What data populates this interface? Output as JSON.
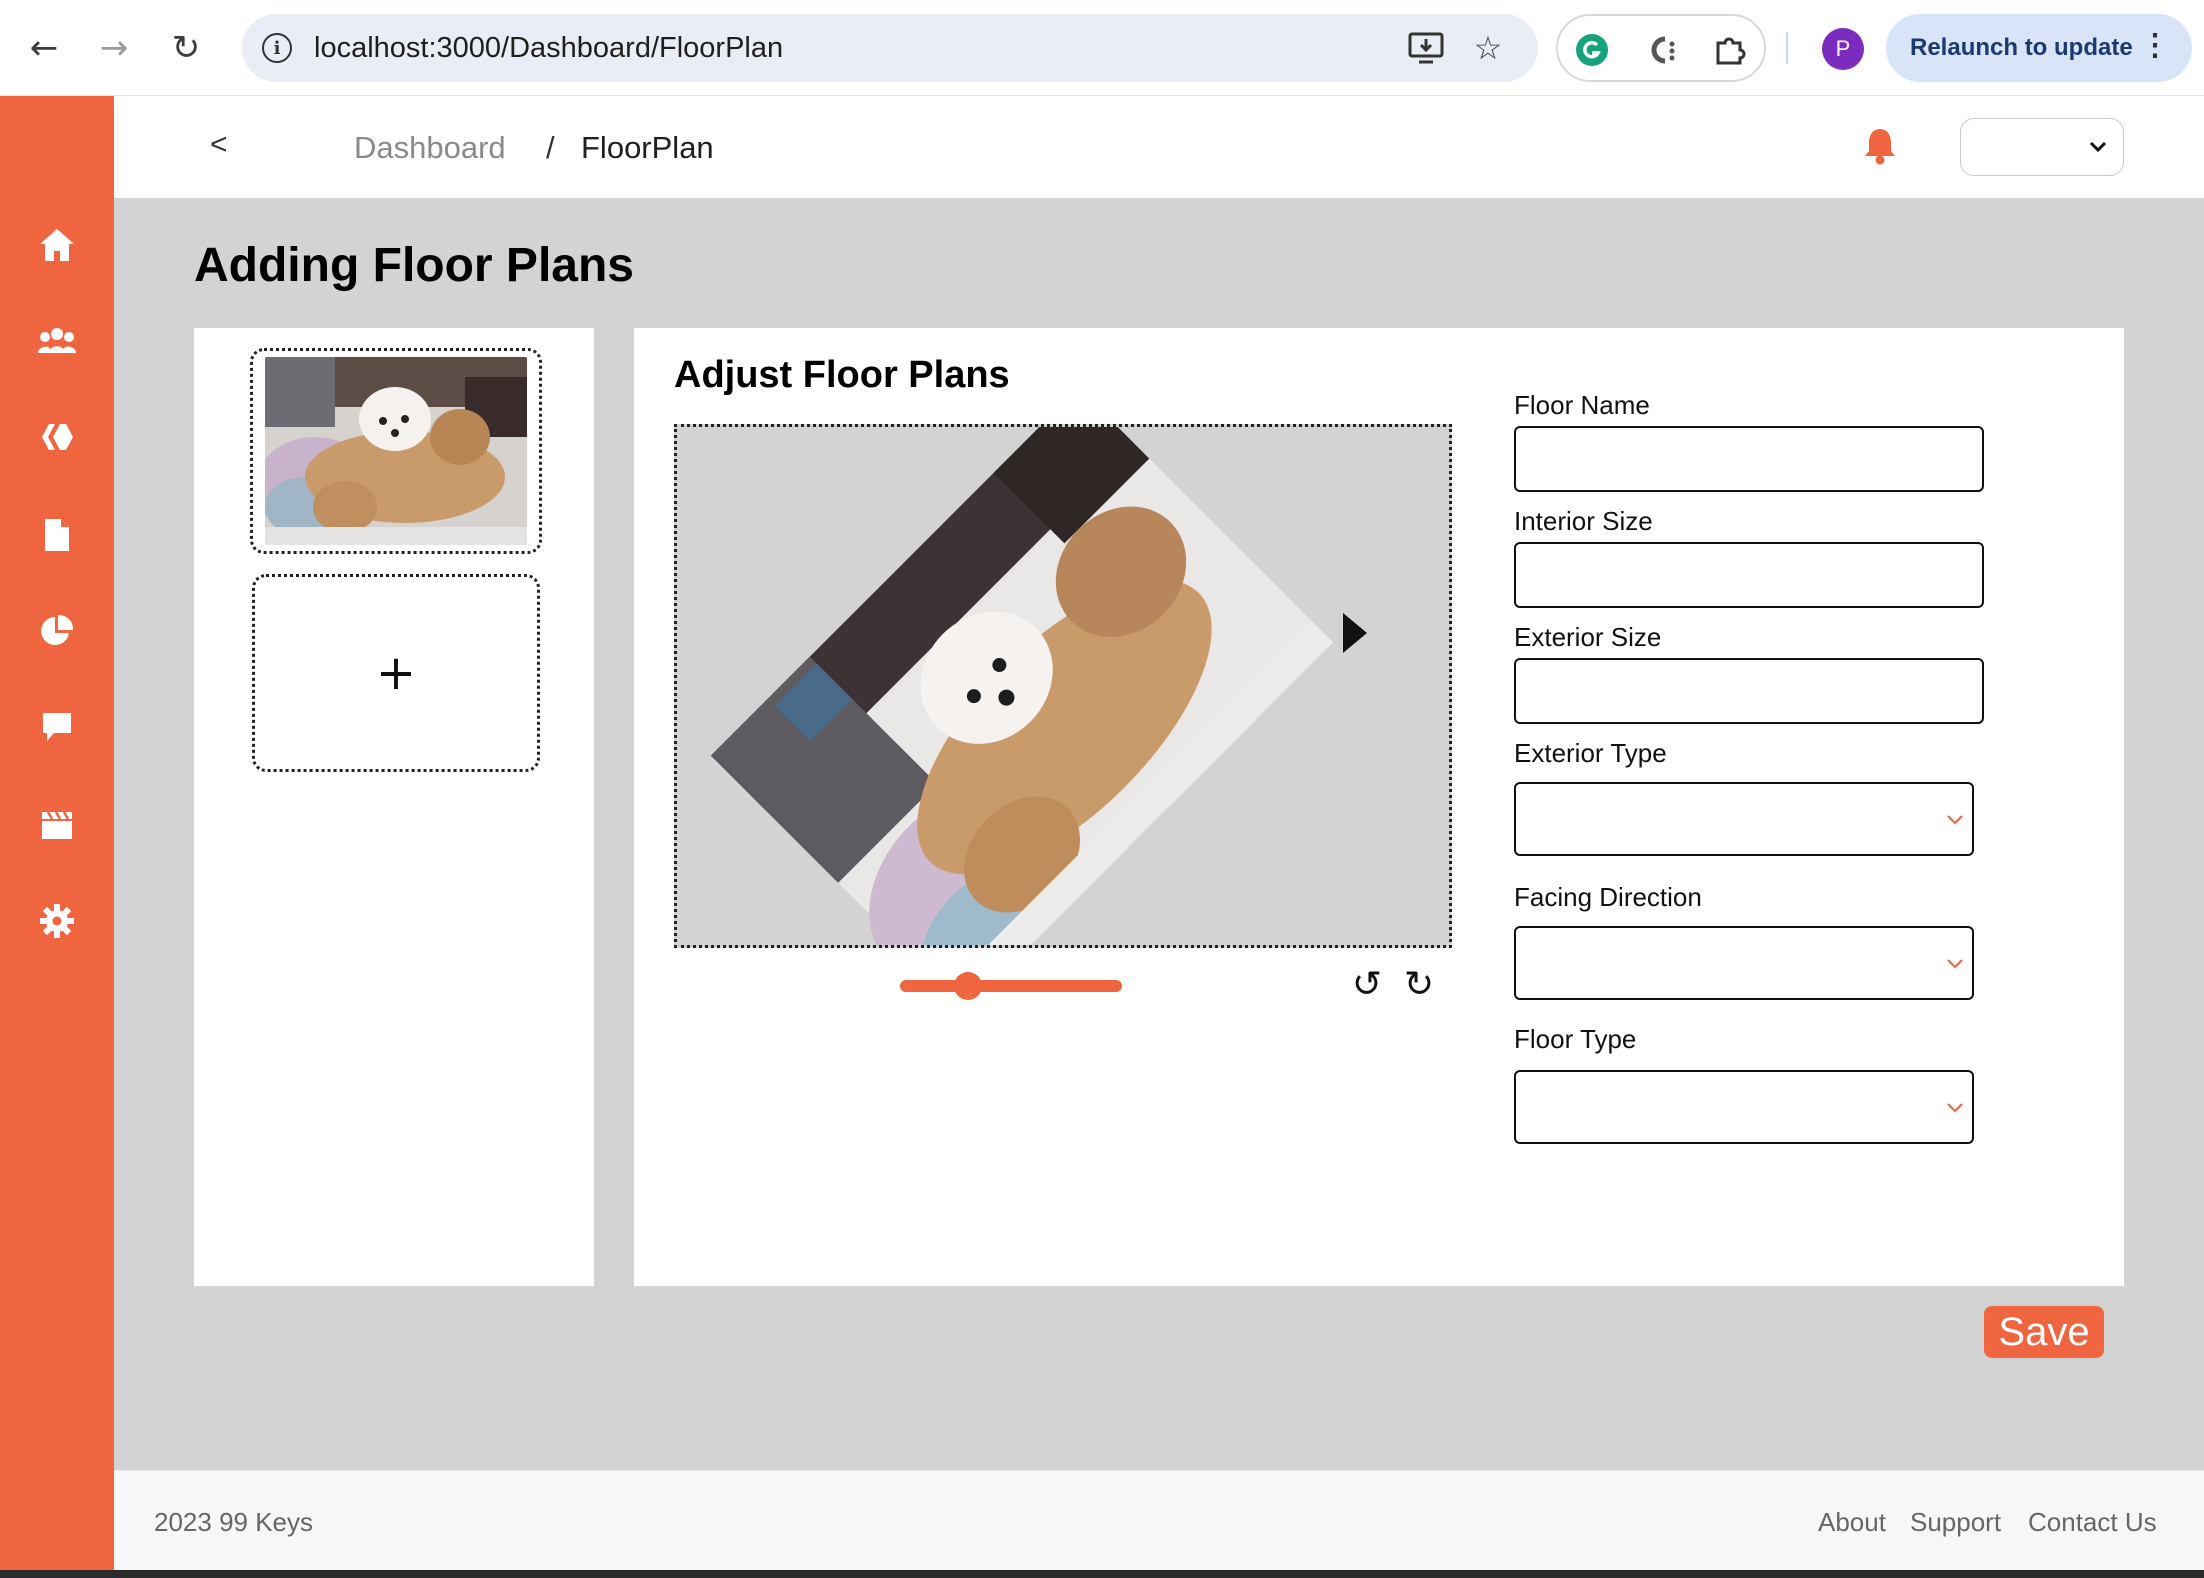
{
  "browser": {
    "url": "localhost:3000/Dashboard/FloorPlan",
    "profile_initial": "P",
    "relaunch_label": "Relaunch to update"
  },
  "header": {
    "back_label": "<",
    "breadcrumb": [
      "Dashboard",
      "FloorPlan"
    ],
    "breadcrumb_separator": "/"
  },
  "sidebar": {
    "items": [
      "home-icon",
      "people-icon",
      "hive-icon",
      "document-icon",
      "pie-chart-icon",
      "chat-icon",
      "clapperboard-icon",
      "gear-icon"
    ]
  },
  "page": {
    "title": "Adding Floor Plans",
    "add_slot_label": "+"
  },
  "editor": {
    "title": "Adjust Floor Plans",
    "zoom_level": 0.28,
    "rotate_left": "↺",
    "rotate_right": "↻"
  },
  "form": {
    "floor_name_label": "Floor Name",
    "interior_size_label": "Interior Size",
    "exterior_size_label": "Exterior Size",
    "exterior_type_label": "Exterior Type",
    "facing_direction_label": "Facing Direction",
    "floor_type_label": "Floor Type"
  },
  "actions": {
    "save_label": "Save"
  },
  "footer": {
    "copyright": "2023 99 Keys",
    "links": [
      "About",
      "Support",
      "Contact Us"
    ]
  },
  "colors": {
    "accent": "#ef6540",
    "background": "#d3d3d3",
    "panel": "#ffffff"
  }
}
